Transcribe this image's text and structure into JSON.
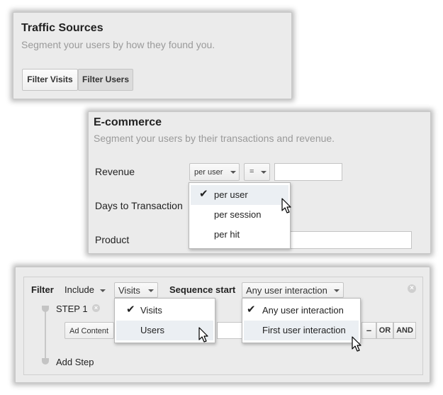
{
  "traffic_sources": {
    "title": "Traffic Sources",
    "subtitle": "Segment your users by how they found you.",
    "filter_visits_label": "Filter Visits",
    "filter_users_label": "Filter Users"
  },
  "ecommerce": {
    "title": "E-commerce",
    "subtitle": "Segment your users by their transactions and revenue.",
    "revenue_label": "Revenue",
    "days_label": "Days to Transaction",
    "product_label": "Product",
    "scope_dropdown_value": "per user",
    "operator_dropdown_value": "=",
    "scope_menu": {
      "items": [
        "per user",
        "per session",
        "per hit"
      ],
      "checked_index": 0,
      "highlighted_index": 0
    }
  },
  "sequence_filter": {
    "filter_label": "Filter",
    "include_value": "Include",
    "visits_value": "Visits",
    "sequence_start_label": "Sequence start",
    "sequence_start_value": "Any user interaction",
    "step_label": "STEP 1",
    "ad_content_value": "Ad Content",
    "minus_label": "–",
    "or_label": "OR",
    "and_label": "AND",
    "add_step_label": "Add Step",
    "visits_menu": {
      "items": [
        "Visits",
        "Users"
      ],
      "checked_index": 0,
      "highlighted_index": 1
    },
    "sequence_menu": {
      "items": [
        "Any user interaction",
        "First user interaction"
      ],
      "checked_index": 0,
      "highlighted_index": 1
    }
  }
}
